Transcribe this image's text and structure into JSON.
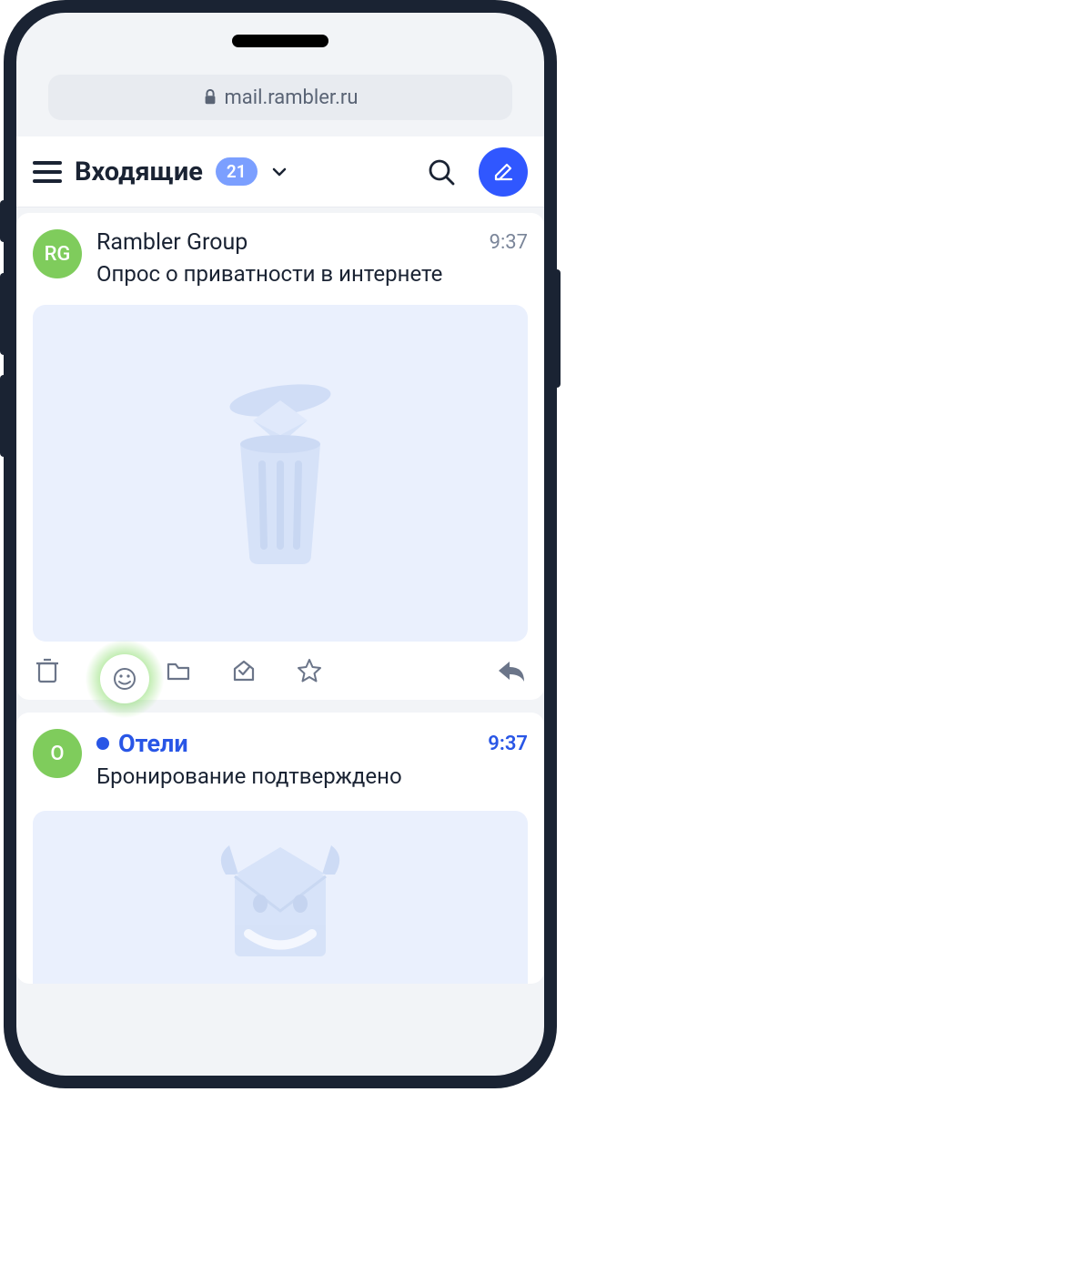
{
  "browser": {
    "url": "mail.rambler.ru"
  },
  "header": {
    "folder_name": "Входящие",
    "unread_count": "21"
  },
  "emails": [
    {
      "avatar_initials": "RG",
      "sender": "Rambler Group",
      "time": "9:37",
      "subject": "Опрос о приватности в интернете",
      "unread": false
    },
    {
      "avatar_initials": "O",
      "sender": "Отели",
      "time": "9:37",
      "subject": "Бронирование подтверждено",
      "unread": true
    }
  ],
  "actions": {
    "delete": "delete",
    "smile": "smile",
    "folder": "folder",
    "mark_read": "mark-read",
    "star": "star",
    "reply": "reply"
  }
}
